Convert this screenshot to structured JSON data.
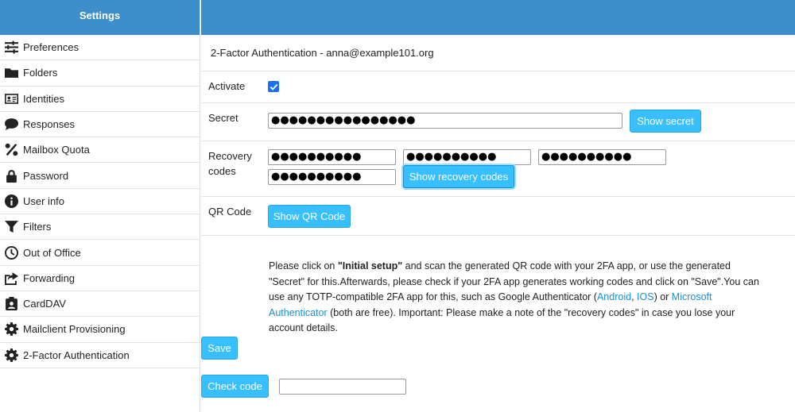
{
  "sidebar": {
    "title": "Settings",
    "items": [
      {
        "label": "Preferences",
        "icon": "sliders-icon"
      },
      {
        "label": "Folders",
        "icon": "folder-icon"
      },
      {
        "label": "Identities",
        "icon": "id-card-icon"
      },
      {
        "label": "Responses",
        "icon": "speech-bubble-icon"
      },
      {
        "label": "Mailbox Quota",
        "icon": "percent-icon"
      },
      {
        "label": "Password",
        "icon": "lock-icon"
      },
      {
        "label": "User info",
        "icon": "info-icon"
      },
      {
        "label": "Filters",
        "icon": "filter-icon"
      },
      {
        "label": "Out of Office",
        "icon": "clock-icon"
      },
      {
        "label": "Forwarding",
        "icon": "share-icon"
      },
      {
        "label": "CardDAV",
        "icon": "contact-card-icon"
      },
      {
        "label": "Mailclient Provisioning",
        "icon": "gear-icon"
      },
      {
        "label": "2-Factor Authentication",
        "icon": "gear-icon"
      }
    ]
  },
  "main": {
    "title": "2-Factor Authentication - anna@example101.org",
    "activate_label": "Activate",
    "activate_checked": true,
    "secret_label": "Secret",
    "secret_value": "●●●●●●●●●●●●●●●●",
    "show_secret_label": "Show secret",
    "recovery_label_line1": "Recovery",
    "recovery_label_line2": "codes",
    "recovery_codes": [
      "●●●●●●●●●●",
      "●●●●●●●●●●",
      "●●●●●●●●●●",
      "●●●●●●●●●●"
    ],
    "show_recovery_label": "Show recovery codes",
    "qr_label": "QR Code",
    "show_qr_label": "Show QR Code",
    "help": {
      "p1": "Please click on ",
      "initial_setup": "\"Initial setup\"",
      "p2": " and scan the generated QR code with your 2FA app, or use the generated \"Secret\" for this.Afterwards, please check if your 2FA app generates working codes and click on \"Save\".You can use any TOTP-compatible 2FA app for this, such as Google Authenticator (",
      "android": "Android",
      "sep": ", ",
      "ios": "IOS",
      "p3": ") or ",
      "microsoft": "Microsoft Authenticator",
      "p4": " (both are free). Important: Please make a note of the \"recovery codes\" in case you lose your account details."
    },
    "save_label": "Save",
    "check_code_label": "Check code",
    "check_code_value": ""
  },
  "colors": {
    "header": "#3d8ecb",
    "button": "#37bfff",
    "link": "#1a8fd1",
    "checkbox": "#1a73e8"
  }
}
